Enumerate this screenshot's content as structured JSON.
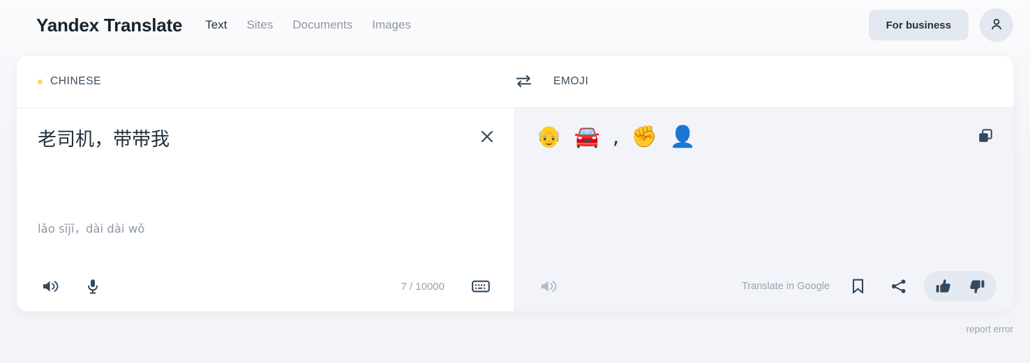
{
  "header": {
    "brand": "Yandex Translate",
    "nav": [
      {
        "label": "Text",
        "active": true
      },
      {
        "label": "Sites",
        "active": false
      },
      {
        "label": "Documents",
        "active": false
      },
      {
        "label": "Images",
        "active": false
      }
    ],
    "for_business_label": "For business",
    "account_icon": "user-avatar-icon"
  },
  "translator": {
    "source_language": "CHINESE",
    "target_language": "EMOJI",
    "swap_icon": "swap-arrows-icon",
    "source_dot_color": "#fcd85c",
    "source_text": "老司机，带带我",
    "source_transcription": "lǎo sījī，dài dài wǒ",
    "clear_icon": "close-x-icon",
    "char_counter": "7 / 10000",
    "keyboard_icon": "keyboard-icon",
    "listen_icon": "speaker-icon",
    "microphone_icon": "microphone-icon",
    "target_text": "👴 🚘 , ✊ 👤",
    "copy_icon": "copy-icon",
    "target_listen_icon": "speaker-icon",
    "google_link_label": "Translate in Google",
    "bookmark_icon": "bookmark-icon",
    "share_icon": "share-icon",
    "thumbs_up_icon": "thumbs-up-icon",
    "thumbs_down_icon": "thumbs-down-icon"
  },
  "footer": {
    "report_error_label": "report error"
  },
  "colors": {
    "accent_yellow": "#fcd85c",
    "text_dark": "#21313d",
    "text_muted": "#8e97a6",
    "panel_bg": "#f2f4f9",
    "pill_bg": "#e4e9f1"
  }
}
